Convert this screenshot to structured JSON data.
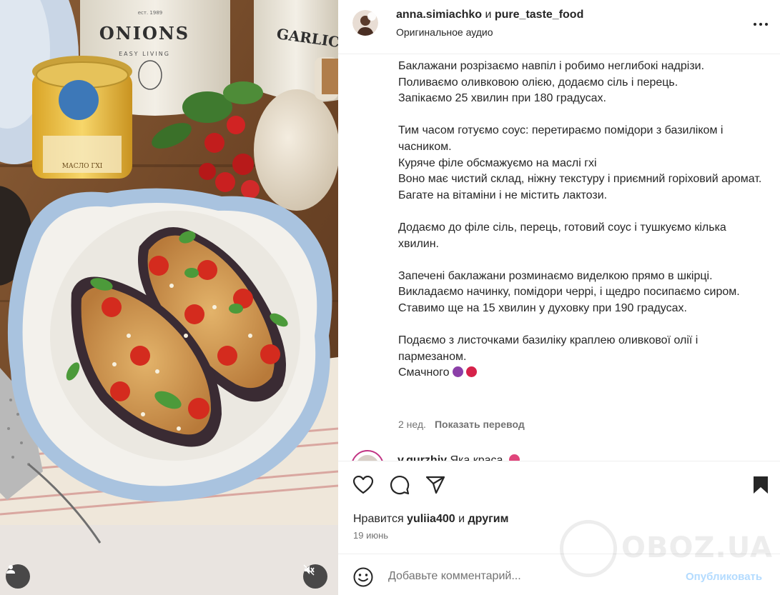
{
  "media": {
    "jar_labels": [
      "ONIONS",
      "EASY LIVING",
      "GARLIC",
      "ест. 1989"
    ],
    "ghee_label": "МАСЛО ГХІ",
    "controls": {
      "user_tag_icon": "user-icon",
      "mute_icon": "speaker-muted-icon"
    }
  },
  "header": {
    "author": "anna.simiachko",
    "joiner": " и ",
    "coauthor": "pure_taste_food",
    "audio": "Оригинальное аудио",
    "more_icon": "more-horizontal-icon"
  },
  "caption": {
    "lines": [
      "Баклажани розрізаємо навпіл і робимо неглибокі надрізи.",
      "Поливаємо оливковою олією, додаємо сіль і перець.",
      "Запікаємо 25 хвилин при 180 градусах.",
      "",
      "Тим часом готуємо соус: перетираємо помідори з базиліком і часником.",
      "Куряче філе обсмажуємо на маслі гхі",
      "Воно має чистий склад, ніжну текстуру і приємний горіховий аромат.",
      "Багате на вітаміни і не містить лактози.",
      "",
      "Додаємо до філе сіль, перець, готовий соус і тушкуємо кілька хвилин.",
      "",
      "Запечені баклажани розминаємо виделкою прямо в шкірці.",
      "Викладаємо начинку, помідори черрі, і щедро посипаємо сиром.",
      "Ставимо ще на 15 хвилин у духовку при 190 градусах.",
      "",
      "Подаємо з листочками базиліку краплею оливкової олії і пармезаном."
    ],
    "last_line": "Смачного",
    "emojis": [
      "eggplant-emoji",
      "tomato-emoji"
    ],
    "age": "2 нед.",
    "translate": "Показать перевод"
  },
  "comment": {
    "username": "v.gurzhiy",
    "text": " Яка краса"
  },
  "actions": {
    "icons": [
      "heart-icon",
      "comment-icon",
      "share-icon",
      "bookmark-icon"
    ],
    "likes_prefix": "Нравится ",
    "likes_user": "yuliia400",
    "likes_middle": " и ",
    "likes_suffix": "другим",
    "date": "19 июнь"
  },
  "add_comment": {
    "placeholder": "Добавьте комментарий...",
    "post_label": "Опубликовать",
    "emoji_icon": "smile-icon"
  },
  "watermark": {
    "text": "OBOZ.UA"
  },
  "colors": {
    "text": "#262626",
    "secondary": "#737373",
    "border": "#efefef",
    "post_disabled": "#b3dbff",
    "story_ring": "#c13584"
  }
}
